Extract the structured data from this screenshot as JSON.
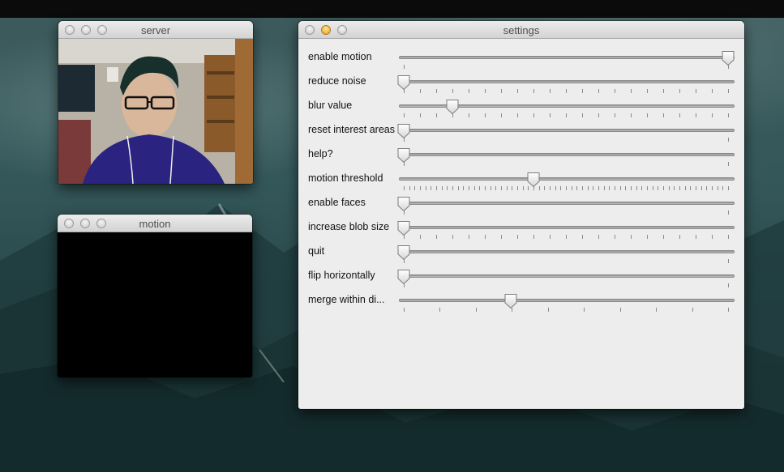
{
  "windows": {
    "server": {
      "title": "server"
    },
    "motion": {
      "title": "motion"
    },
    "settings": {
      "title": "settings"
    }
  },
  "settings": {
    "sliders": [
      {
        "label": "enable motion",
        "value": 1.0,
        "ticks": 1
      },
      {
        "label": "reduce noise",
        "value": 0.0,
        "ticks": 21
      },
      {
        "label": "blur value",
        "value": 0.15,
        "ticks": 21
      },
      {
        "label": "reset interest areas",
        "value": 0.0,
        "ticks": 1
      },
      {
        "label": "help?",
        "value": 0.0,
        "ticks": 1
      },
      {
        "label": "motion threshold",
        "value": 0.4,
        "ticks": 61
      },
      {
        "label": "enable faces",
        "value": 0.0,
        "ticks": 1
      },
      {
        "label": "increase blob size",
        "value": 0.0,
        "ticks": 21
      },
      {
        "label": "quit",
        "value": 0.0,
        "ticks": 1
      },
      {
        "label": "flip horizontally",
        "value": 0.0,
        "ticks": 1
      },
      {
        "label": "merge within di...",
        "value": 0.33,
        "ticks": 10
      }
    ]
  },
  "colors": {
    "minimize_active": "#e0a11e",
    "panel_bg": "#ededed",
    "menubar": "#0b0b0b"
  }
}
